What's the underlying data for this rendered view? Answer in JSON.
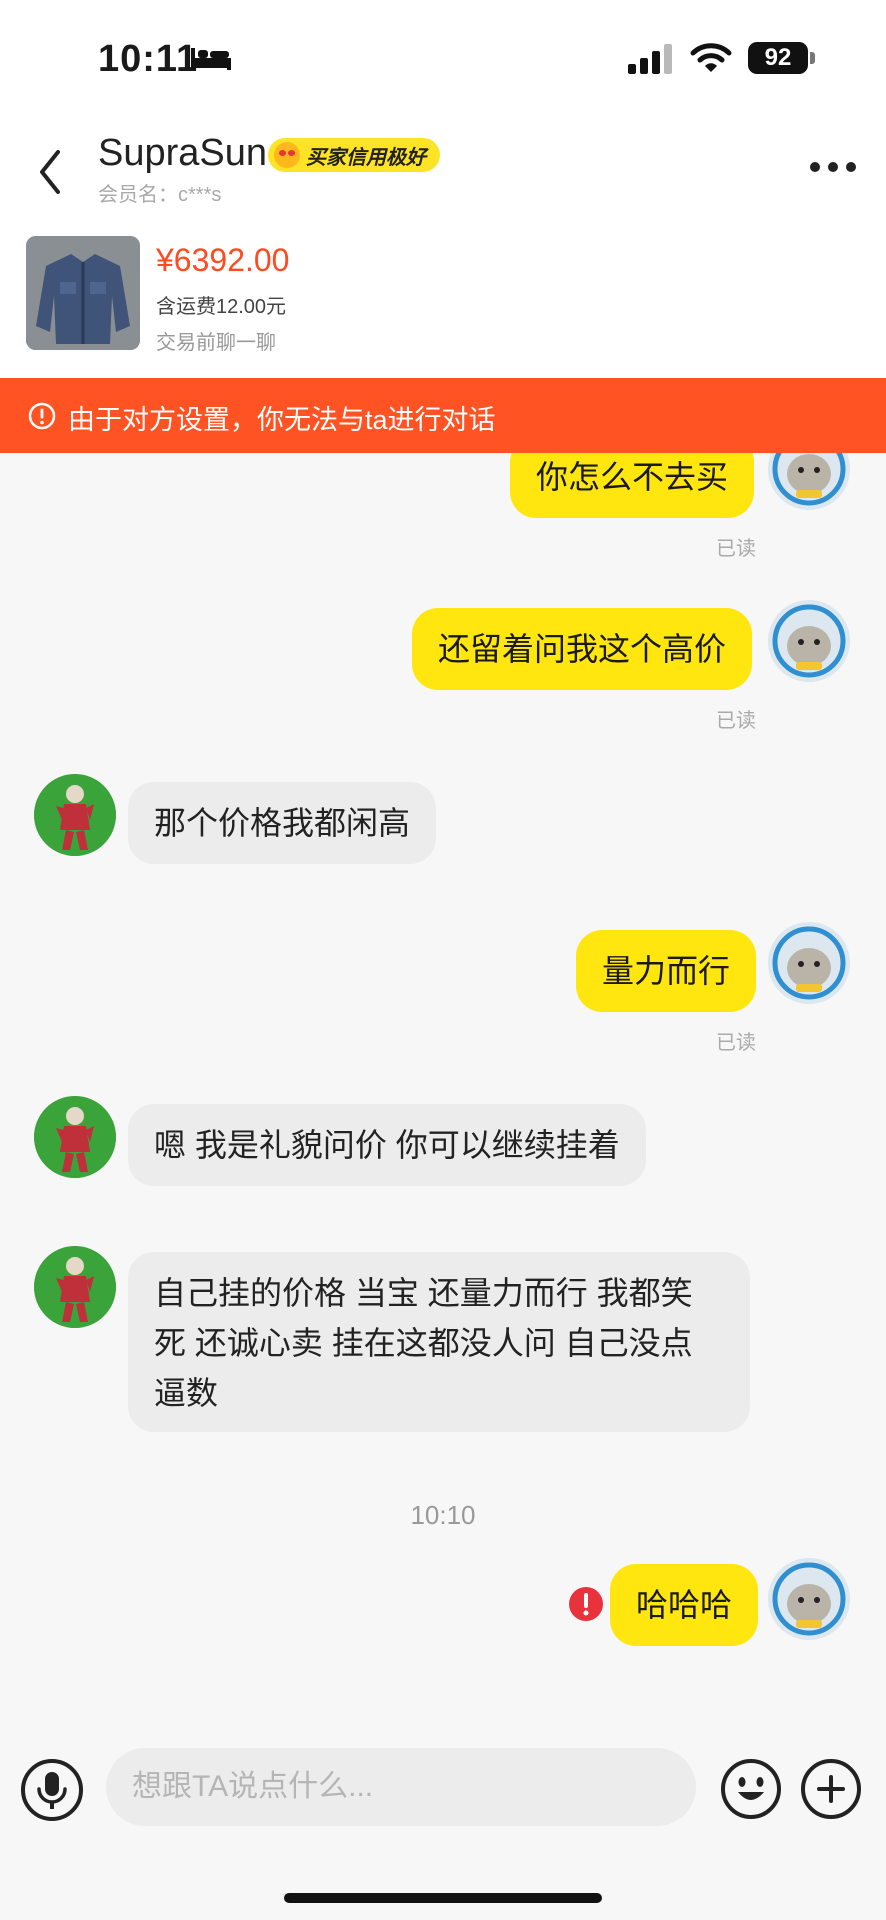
{
  "status_bar": {
    "time": "10:11",
    "battery": "92"
  },
  "header": {
    "seller_name": "SupraSun",
    "credit_badge": "买家信用极好",
    "member_label": "会员名：c***s",
    "price": "¥6392.00",
    "shipping": "含运费12.00元",
    "pre_chat": "交易前聊一聊"
  },
  "warning": {
    "text": "由于对方设置，你无法与ta进行对话"
  },
  "messages": [
    {
      "side": "me",
      "text": "你怎么不去买",
      "status": "已读"
    },
    {
      "side": "me",
      "text": "还留着问我这个高价",
      "status": "已读"
    },
    {
      "side": "them",
      "text": "那个价格我都闲高"
    },
    {
      "side": "me",
      "text": "量力而行",
      "status": "已读"
    },
    {
      "side": "them",
      "text": "嗯 我是礼貌问价 你可以继续挂着"
    },
    {
      "side": "them",
      "lines": [
        "自己挂的价格  当宝 还量力而行 我都笑",
        "死 还诚心卖 挂在这都没人问 自己没点",
        "逼数"
      ]
    },
    {
      "side": "me",
      "text": "哈哈哈",
      "failed": true
    }
  ],
  "timestamp": "10:10",
  "input": {
    "placeholder": "想跟TA说点什么..."
  },
  "colors": {
    "accent_yellow": "#ffe60f",
    "warning_orange": "#ff5323",
    "price_red": "#ff4b1f"
  }
}
